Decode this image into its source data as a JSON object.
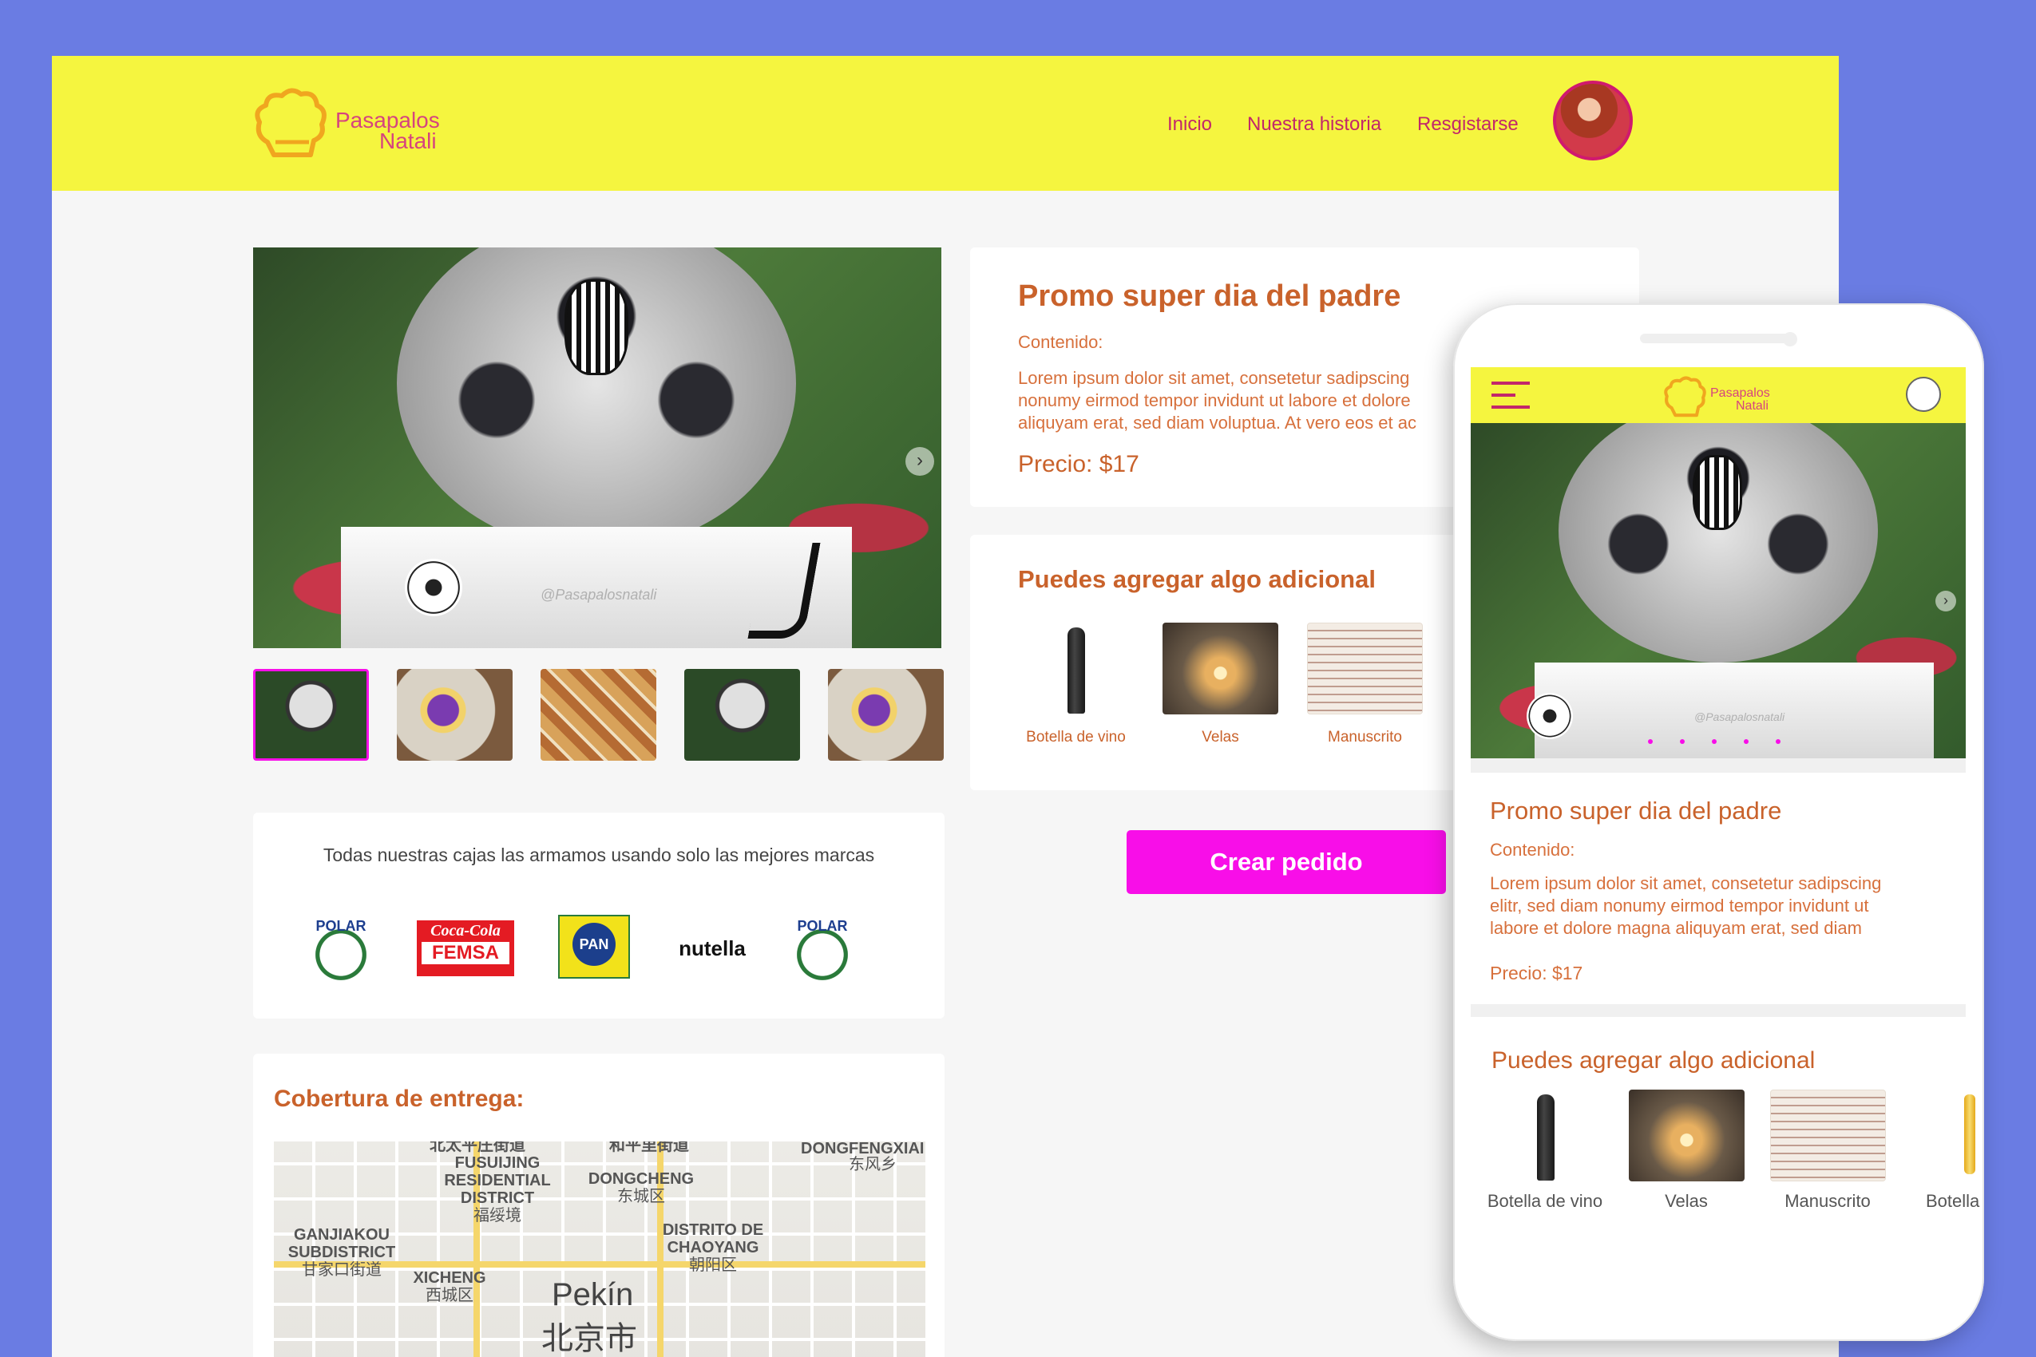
{
  "brand": {
    "name_line1": "Pasapalos",
    "name_line2": "Natali"
  },
  "nav": {
    "items": [
      "Inicio",
      "Nuestra historia",
      "Resgistarse"
    ]
  },
  "product": {
    "title": "Promo super dia del padre",
    "content_label": "Contenido:",
    "desc_line1": "Lorem ipsum dolor sit amet, consetetur sadipscing",
    "desc_line2": "nonumy eirmod tempor invidunt ut labore et dolore",
    "desc_line3": "aliquyam erat, sed diam voluptua. At vero eos et ac",
    "price": "Precio: $17",
    "box_stamp": "@Pasapalosnatali"
  },
  "addons": {
    "title": "Puedes agregar algo adicional",
    "items": [
      "Botella de vino",
      "Velas",
      "Manuscrito"
    ]
  },
  "cta_label": "Crear pedido",
  "brands": {
    "intro": "Todas nuestras cajas las armamos usando solo las mejores marcas",
    "logos": [
      "POLAR",
      "Coca-Cola",
      "FEMSA",
      "PAN",
      "nutella",
      "POLAR"
    ]
  },
  "coverage": {
    "title": "Cobertura de entrega:",
    "map_labels": {
      "top_cut1": "北太平庄街道",
      "top_cut2": "和平里街道",
      "dongfengxiang": "DONGFENGXIAI",
      "dongfengxiang_cn": "东风乡",
      "fusuijing1": "FUSUIJING",
      "fusuijing2": "RESIDENTIAL",
      "fusuijing3": "DISTRICT",
      "fusuijing_cn": "福绥境",
      "dongcheng": "DONGCHENG",
      "dongcheng_cn": "东城区",
      "ganjiakou1": "GANJIAKOU",
      "ganjiakou2": "SUBDISTRICT",
      "ganjiakou_cn": "甘家口街道",
      "chaoyang1": "DISTRITO DE",
      "chaoyang2": "CHAOYANG",
      "chaoyang_cn": "朝阳区",
      "xicheng": "XICHENG",
      "xicheng_cn": "西城区",
      "city": "Pekín",
      "city_cn": "北京市"
    }
  },
  "mobile": {
    "title": "Promo super dia del padre",
    "content_label": "Contenido:",
    "desc_line1": "Lorem ipsum dolor sit amet, consetetur sadipscing",
    "desc_line2": "elitr, sed diam nonumy eirmod tempor invidunt ut",
    "desc_line3": "labore et dolore magna aliquyam erat, sed diam",
    "price": "Precio: $17",
    "addons_title": "Puedes agregar algo adicional",
    "addon_items": [
      "Botella de vino",
      "Velas",
      "Manuscrito",
      "Botella"
    ]
  },
  "colors": {
    "background": "#6a7ce3",
    "header": "#f5f53f",
    "accent": "#c9622b",
    "nav": "#c2276a",
    "cta": "#f80ee8"
  }
}
